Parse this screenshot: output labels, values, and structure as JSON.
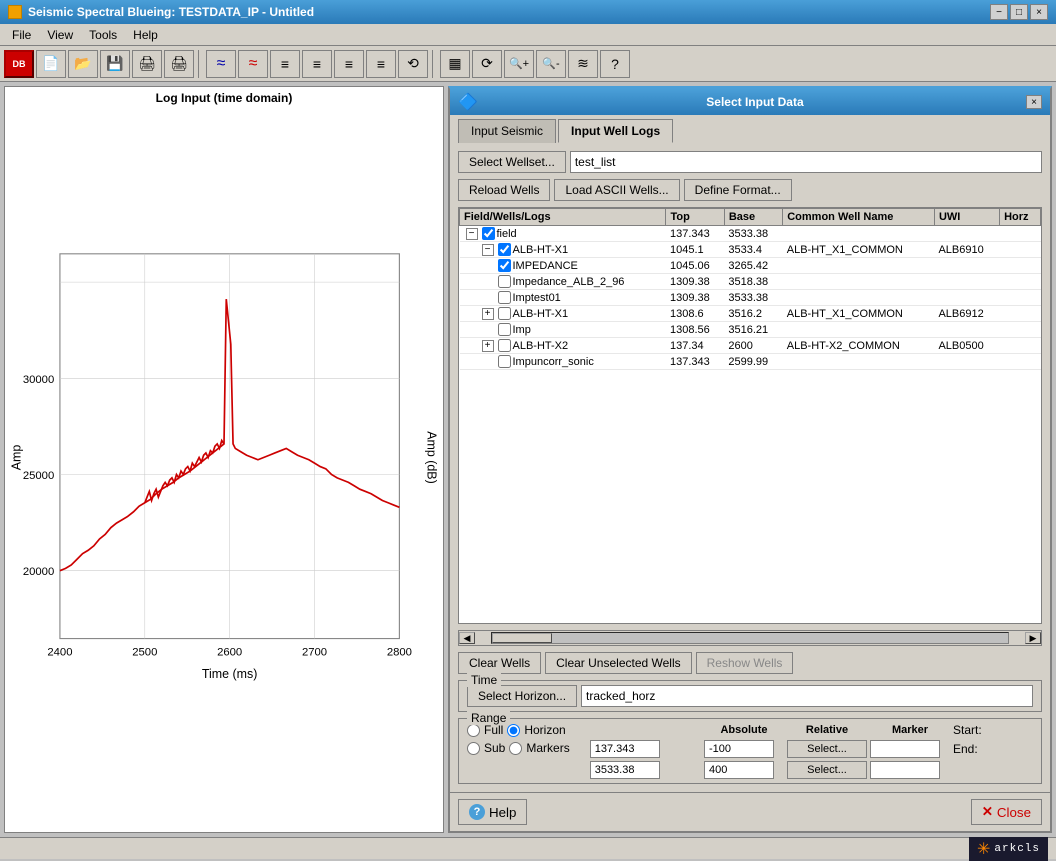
{
  "window": {
    "title": "Seismic Spectral Blueing: TESTDATA_IP - Untitled",
    "min_btn": "−",
    "max_btn": "□",
    "close_btn": "×"
  },
  "menu": {
    "items": [
      "File",
      "View",
      "Tools",
      "Help"
    ]
  },
  "toolbar": {
    "icons": [
      "DB",
      "📄",
      "📂",
      "💾",
      "🖨",
      "🖨",
      "📊",
      "📊",
      "≡",
      "≡",
      "≡",
      "≡",
      "⟲",
      "▦",
      "⟳",
      "🔍+",
      "🔍-",
      "≋",
      "?"
    ]
  },
  "chart": {
    "title": "Log Input (time domain)",
    "x_label": "Time (ms)",
    "y_label": "Amp",
    "y_right_label": "Amp (dB)",
    "x_ticks": [
      "2400",
      "2500",
      "2600",
      "2700",
      "2800"
    ],
    "y_ticks": [
      "20000",
      "25000",
      "30000"
    ],
    "y_top": "35000"
  },
  "dialog": {
    "title": "Select Input Data",
    "close_icon": "×",
    "tabs": [
      {
        "label": "Input Seismic",
        "active": false
      },
      {
        "label": "Input Well Logs",
        "active": true
      }
    ],
    "wellset_btn": "Select Wellset...",
    "wellset_value": "test_list",
    "wells_buttons": [
      {
        "label": "Reload Wells",
        "name": "reload-wells-btn"
      },
      {
        "label": "Load ASCII Wells...",
        "name": "load-ascii-btn"
      },
      {
        "label": "Define Format...",
        "name": "define-format-btn"
      }
    ],
    "table": {
      "columns": [
        "Field/Wells/Logs",
        "Top",
        "Base",
        "Common Well Name",
        "UWI",
        "Horz"
      ],
      "rows": [
        {
          "level": 0,
          "expanded": true,
          "checked": true,
          "type": "field",
          "name": "field",
          "top": "137.343",
          "base": "3533.38",
          "common_name": "",
          "uwi": "",
          "horz": ""
        },
        {
          "level": 1,
          "expanded": true,
          "checked": true,
          "type": "well",
          "name": "ALB-HT-X1",
          "top": "1045.1",
          "base": "3533.4",
          "common_name": "ALB-HT_X1_COMMON",
          "uwi": "ALB6910",
          "horz": ""
        },
        {
          "level": 2,
          "expanded": false,
          "checked": true,
          "type": "log",
          "name": "IMPEDANCE",
          "top": "1045.06",
          "base": "3265.42",
          "common_name": "",
          "uwi": "",
          "horz": ""
        },
        {
          "level": 2,
          "expanded": false,
          "checked": false,
          "type": "log",
          "name": "Impedance_ALB_2_96",
          "top": "1309.38",
          "base": "3518.38",
          "common_name": "",
          "uwi": "",
          "horz": ""
        },
        {
          "level": 2,
          "expanded": false,
          "checked": false,
          "type": "log",
          "name": "Imptest01",
          "top": "1309.38",
          "base": "3533.38",
          "common_name": "",
          "uwi": "",
          "horz": ""
        },
        {
          "level": 1,
          "expanded": false,
          "checked": false,
          "type": "well",
          "name": "ALB-HT-X1",
          "top": "1308.6",
          "base": "3516.2",
          "common_name": "ALB-HT_X1_COMMON",
          "uwi": "ALB6912",
          "horz": ""
        },
        {
          "level": 2,
          "expanded": false,
          "checked": false,
          "type": "log",
          "name": "Imp",
          "top": "1308.56",
          "base": "3516.21",
          "common_name": "",
          "uwi": "",
          "horz": ""
        },
        {
          "level": 1,
          "expanded": false,
          "checked": false,
          "type": "well",
          "name": "ALB-HT-X2",
          "top": "137.34",
          "base": "2600",
          "common_name": "ALB-HT-X2_COMMON",
          "uwi": "ALB0500",
          "horz": ""
        },
        {
          "level": 2,
          "expanded": false,
          "checked": false,
          "type": "log",
          "name": "Impuncorr_sonic",
          "top": "137.343",
          "base": "2599.99",
          "common_name": "",
          "uwi": "",
          "horz": ""
        }
      ]
    },
    "bottom_buttons": [
      {
        "label": "Clear Wells",
        "name": "clear-wells-btn"
      },
      {
        "label": "Clear Unselected Wells",
        "name": "clear-unselected-btn"
      },
      {
        "label": "Reshow Wells",
        "name": "reshow-wells-btn"
      }
    ],
    "time_section": {
      "label": "Time",
      "select_horizon_btn": "Select Horizon...",
      "horizon_value": "tracked_horz"
    },
    "range_section": {
      "label": "Range",
      "options": {
        "full": "Full",
        "horizon": "Horizon",
        "sub": "Sub",
        "markers": "Markers"
      },
      "selected_main": "horizon",
      "selected_secondary": "full",
      "cols": [
        "Absolute",
        "Relative",
        "Marker"
      ],
      "start_label": "Start:",
      "end_label": "End:",
      "start_absolute": "137.343",
      "start_relative": "-100",
      "end_absolute": "3533.38",
      "end_relative": "400",
      "start_marker_btn": "Select...",
      "end_marker_btn": "Select...",
      "start_marker_val": "",
      "end_marker_val": ""
    },
    "help_btn": "Help",
    "close_btn": "Close"
  },
  "status_bar": {
    "logo": "arkcls"
  }
}
